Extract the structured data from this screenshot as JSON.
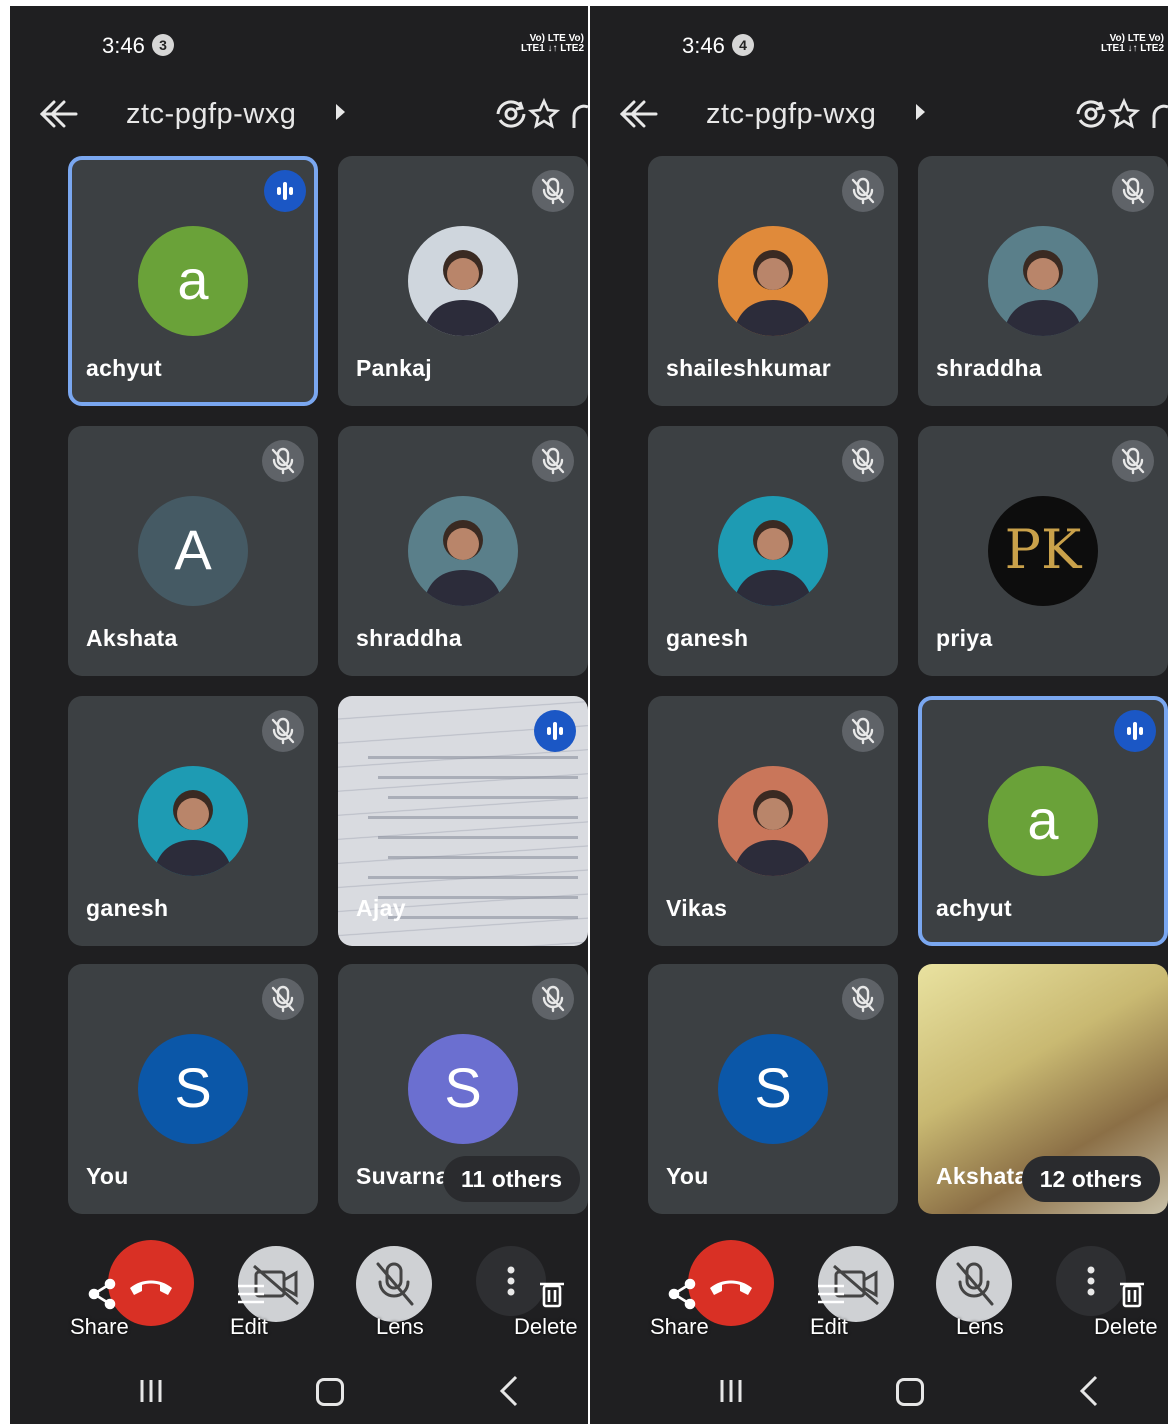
{
  "screens": [
    {
      "status": {
        "time": "3:46",
        "notifications": "3",
        "signal_line1": "Vo) LTE Vo)",
        "signal_line2": "LTE1 ↓↑ LTE2"
      },
      "header": {
        "meeting_code": "ztc-pgfp-wxg"
      },
      "tiles": [
        {
          "name": "achyut",
          "avatar_letter": "a",
          "avatar_color": "#6aa239",
          "state": "speaking"
        },
        {
          "name": "Pankaj",
          "avatar_letter": "",
          "avatar_color": "#cfd6dd",
          "state": "muted",
          "avatar_type": "photo"
        },
        {
          "name": "Akshata",
          "avatar_letter": "A",
          "avatar_color": "#455a64",
          "state": "muted"
        },
        {
          "name": "shraddha",
          "avatar_letter": "",
          "avatar_color": "#5a7f8a",
          "state": "muted",
          "avatar_type": "photo"
        },
        {
          "name": "ganesh",
          "avatar_letter": "",
          "avatar_color": "#1e9bb3",
          "state": "muted",
          "avatar_type": "photo"
        },
        {
          "name": "Ajay",
          "avatar_letter": "",
          "avatar_color": "#d4d6db",
          "state": "talking",
          "avatar_type": "video-paper"
        },
        {
          "name": "You",
          "avatar_letter": "S",
          "avatar_color": "#0b57a8",
          "state": "muted"
        },
        {
          "name": "Suvarna",
          "avatar_letter": "S",
          "avatar_color": "#6b6fd0",
          "state": "muted",
          "others": "11 others"
        }
      ],
      "actions": {
        "share": "Share",
        "edit": "Edit",
        "lens": "Lens",
        "delete": "Delete"
      }
    },
    {
      "status": {
        "time": "3:46",
        "notifications": "4",
        "signal_line1": "Vo) LTE Vo)",
        "signal_line2": "LTE1 ↓↑ LTE2"
      },
      "header": {
        "meeting_code": "ztc-pgfp-wxg"
      },
      "tiles": [
        {
          "name": "shaileshkumar",
          "avatar_letter": "",
          "avatar_color": "#e08a3a",
          "state": "muted",
          "avatar_type": "photo"
        },
        {
          "name": "shraddha",
          "avatar_letter": "",
          "avatar_color": "#5a7f8a",
          "state": "muted",
          "avatar_type": "photo"
        },
        {
          "name": "ganesh",
          "avatar_letter": "",
          "avatar_color": "#1e9bb3",
          "state": "muted",
          "avatar_type": "photo"
        },
        {
          "name": "priya",
          "avatar_letter": "PK",
          "avatar_color": "#0d0d0d",
          "state": "muted"
        },
        {
          "name": "Vikas",
          "avatar_letter": "",
          "avatar_color": "#c9765a",
          "state": "muted",
          "avatar_type": "photo"
        },
        {
          "name": "achyut",
          "avatar_letter": "a",
          "avatar_color": "#6aa239",
          "state": "speaking"
        },
        {
          "name": "You",
          "avatar_letter": "S",
          "avatar_color": "#0b57a8",
          "state": "muted"
        },
        {
          "name": "Akshata",
          "avatar_letter": "",
          "avatar_color": "#c9b972",
          "state": "video",
          "avatar_type": "video-face",
          "others": "12 others"
        }
      ],
      "actions": {
        "share": "Share",
        "edit": "Edit",
        "lens": "Lens",
        "delete": "Delete"
      }
    }
  ]
}
